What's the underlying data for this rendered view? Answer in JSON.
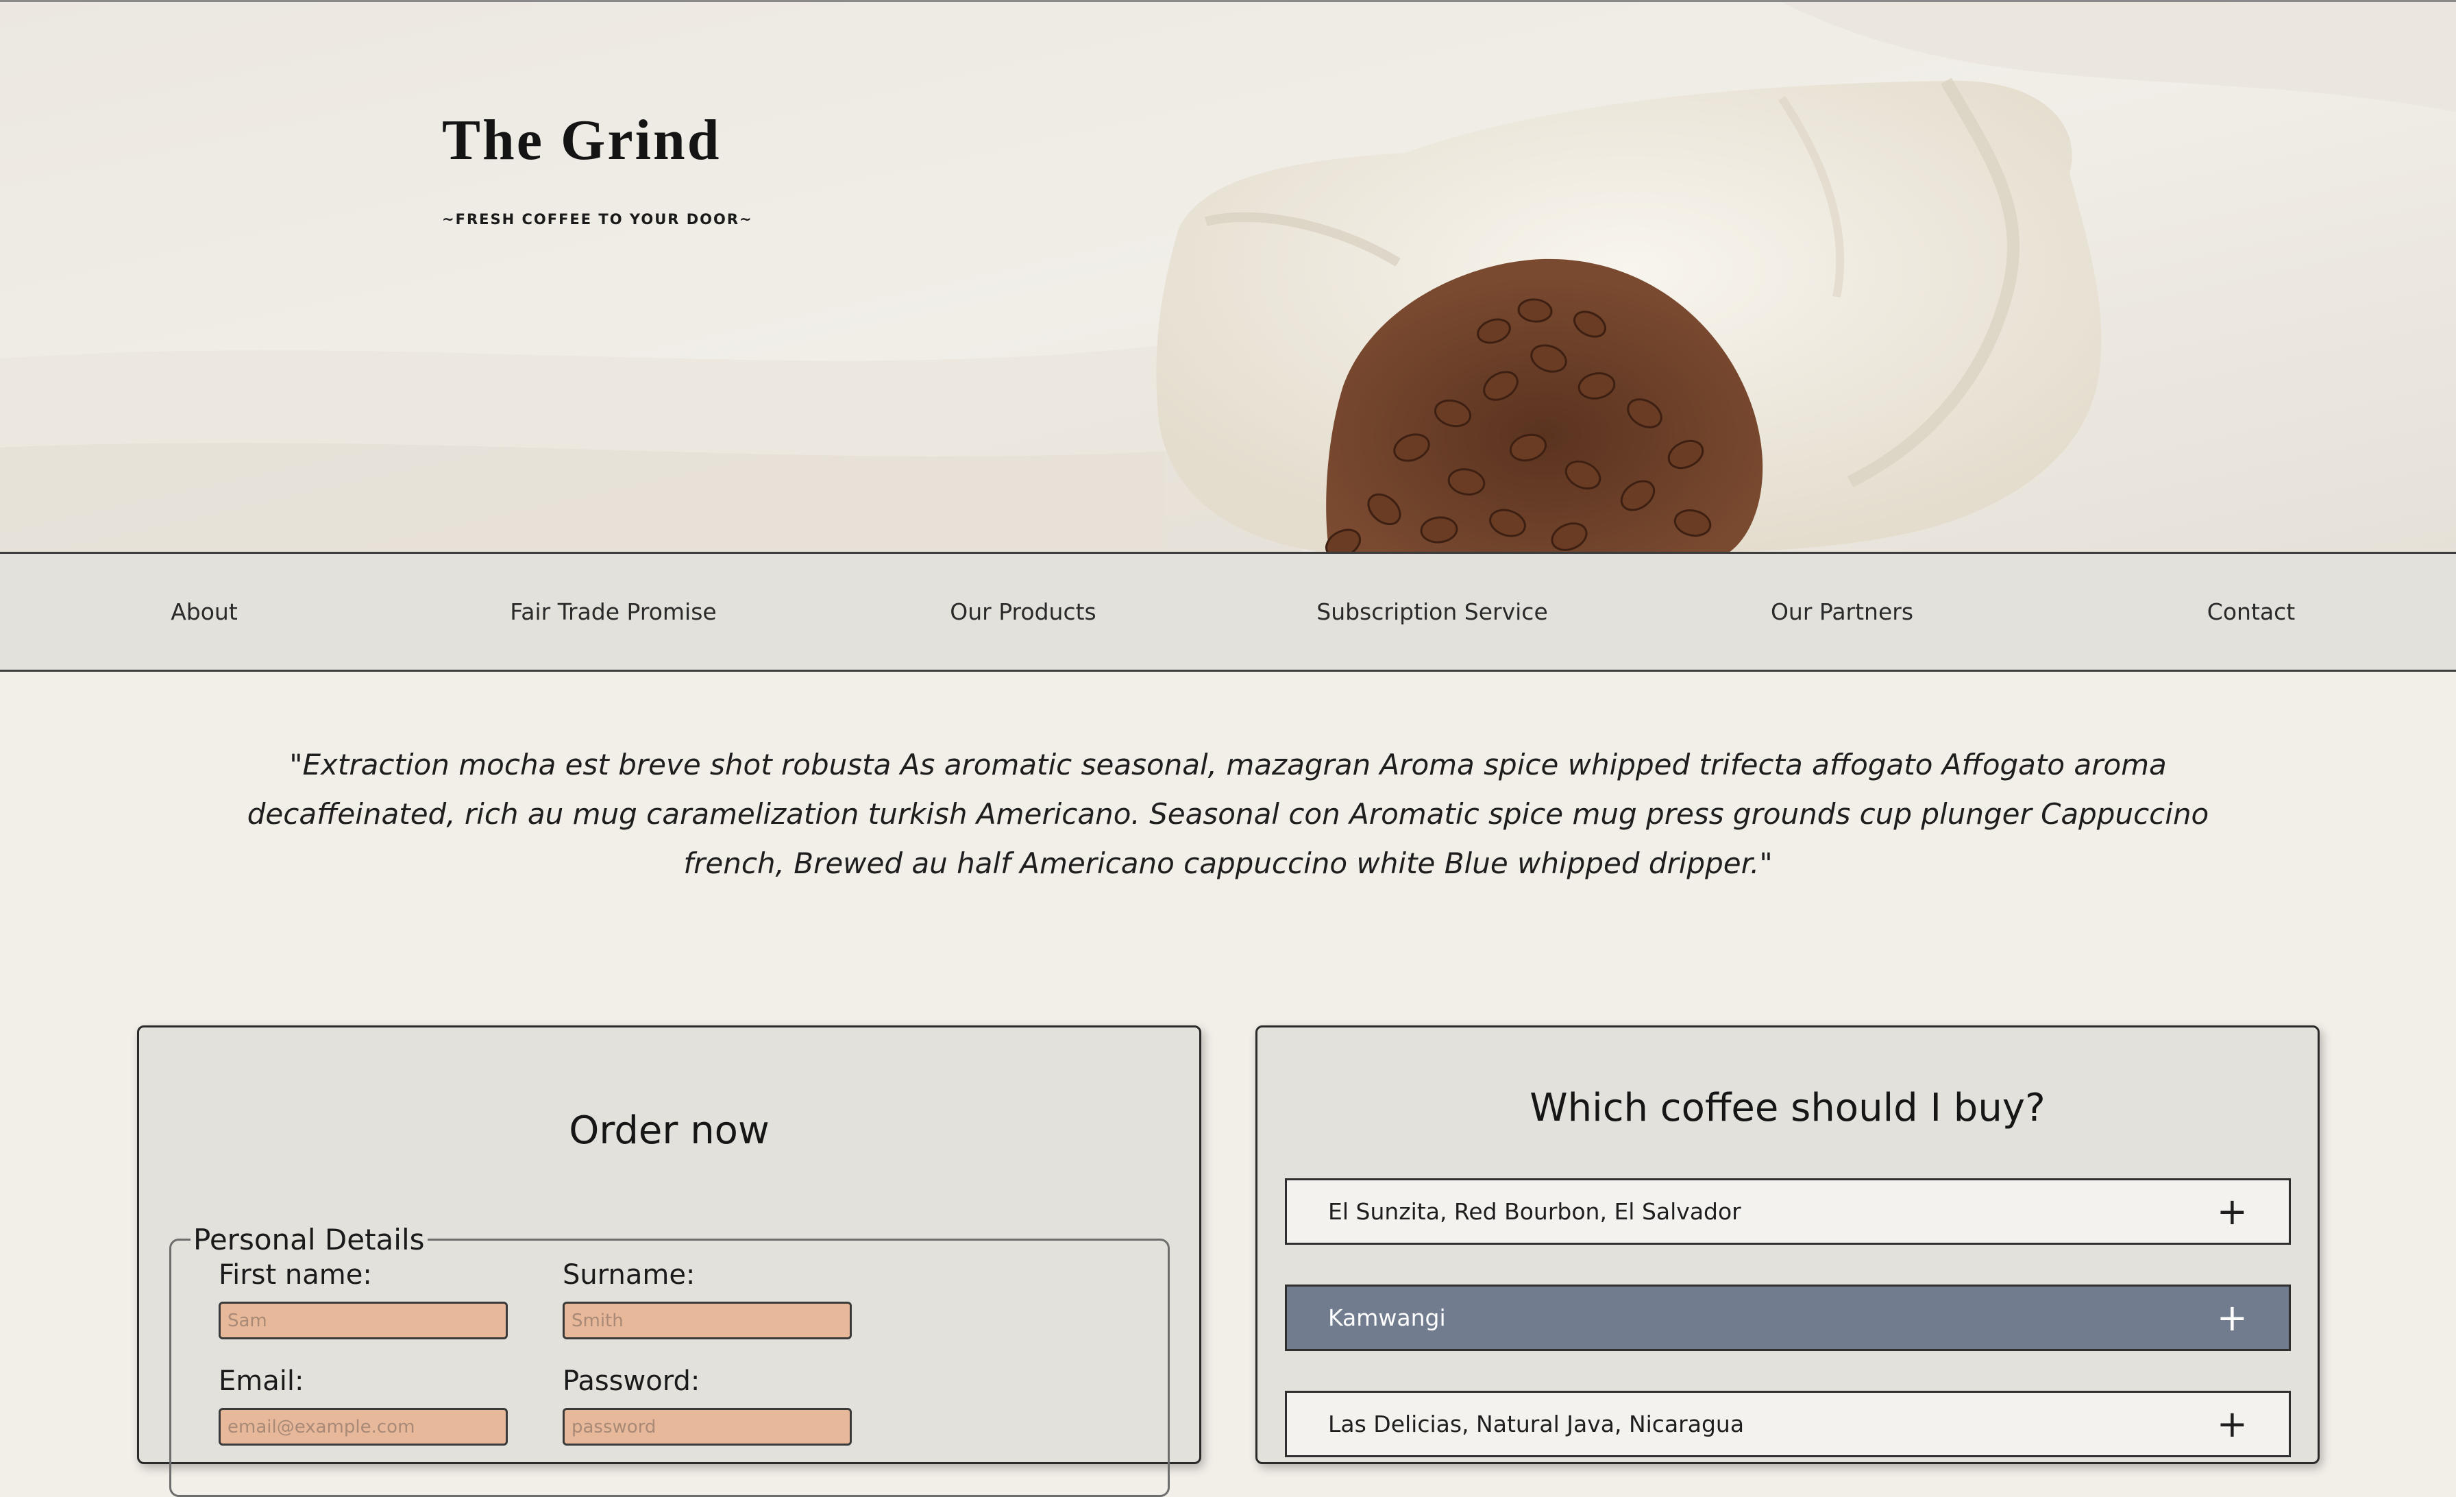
{
  "brand": {
    "title": "The Grind",
    "tagline": "~FRESH COFFEE TO YOUR DOOR~"
  },
  "nav": [
    {
      "label": "About"
    },
    {
      "label": "Fair Trade Promise"
    },
    {
      "label": "Our Products"
    },
    {
      "label": "Subscription Service"
    },
    {
      "label": "Our Partners"
    },
    {
      "label": "Contact"
    }
  ],
  "quote": "\"Extraction mocha est breve shot robusta As aromatic seasonal, mazagran Aroma spice whipped trifecta affogato Affogato aroma decaffeinated, rich au mug caramelization turkish Americano. Seasonal con Aromatic spice mug press grounds cup plunger Cappuccino french, Brewed au half Americano cappuccino white Blue whipped dripper.\"",
  "order": {
    "heading": "Order now",
    "legend": "Personal Details",
    "first_name": {
      "label": "First name:",
      "placeholder": "Sam"
    },
    "surname": {
      "label": "Surname:",
      "placeholder": "Smith"
    },
    "email": {
      "label": "Email:",
      "placeholder": "email@example.com"
    },
    "password": {
      "label": "Password:",
      "placeholder": "password"
    }
  },
  "quiz": {
    "heading": "Which coffee should I buy?",
    "items": [
      {
        "label": "El Sunzita, Red Bourbon, El Salvador",
        "icon": "plus-icon"
      },
      {
        "label": "Kamwangi",
        "icon": "plus-icon"
      },
      {
        "label": "Las Delicias, Natural Java, Nicaragua",
        "icon": "plus-icon"
      }
    ],
    "active_index": 1,
    "active_color": "#717c8f"
  },
  "colors": {
    "page_bg": "#f2eee8",
    "nav_bg": "#e2e1db",
    "card_bg": "#e2e1db",
    "input_bg": "#e8b89b"
  }
}
